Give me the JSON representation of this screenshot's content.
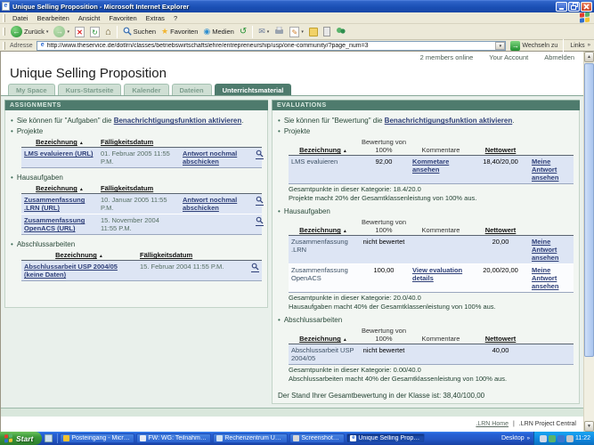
{
  "icons": {
    "ie_e": "e",
    "back": "←",
    "forward": "→",
    "stop": "✕",
    "refresh": "↻",
    "home": "⌂",
    "star": "★",
    "media": "◉",
    "history": "↺",
    "mail": "✉",
    "edit": "✎",
    "dropdown": "▾",
    "chevrons": "»",
    "go": "→",
    "sort": "▲",
    "up": "▲",
    "down": "▼",
    "bullet": "•",
    "pipe": "|"
  },
  "window": {
    "title": "Unique Selling Proposition - Microsoft Internet Explorer",
    "menu": [
      "Datei",
      "Bearbeiten",
      "Ansicht",
      "Favoriten",
      "Extras",
      "?"
    ],
    "toolbar": {
      "back_label": "Zurück",
      "search_label": "Suchen",
      "favorites_label": "Favoriten",
      "media_label": "Medien"
    },
    "addressbar": {
      "label": "Adresse",
      "url": "http://www.theservice.de/dotlrn/classes/betriebswirtschaftslehre/entrepreneurship/usp/one-community/?page_num=3",
      "go_label": "Wechseln zu",
      "links_label": "Links"
    }
  },
  "page": {
    "members_online": "2 members online",
    "your_account": "Your Account",
    "logout": "Abmelden",
    "title": "Unique Selling Proposition",
    "tabs": [
      "My Space",
      "Kurs-Startseite",
      "Kalender",
      "Dateien",
      "Unterrichtsmaterial"
    ],
    "active_tab": "Unterrichtsmaterial",
    "footer": {
      "home": ".LRN Home",
      "sep": "|",
      "central": ".LRN Project Central"
    }
  },
  "assignments": {
    "header": "ASSIGNMENTS",
    "notify": {
      "prefix": "Sie können für \"Aufgaben\" die ",
      "link": "Benachrichtigungsfunktion aktivieren",
      "suffix": "."
    },
    "cols": {
      "name": "Bezeichnung",
      "due": "Fälligkeitsdatum"
    },
    "projekte": {
      "title": "Projekte",
      "rows": [
        {
          "name": "LMS evaluieren (URL)",
          "due": "01. Februar 2005 11:55 P.M.",
          "action": "Antwort nochmal abschicken"
        }
      ]
    },
    "hausaufgaben": {
      "title": "Hausaufgaben",
      "rows": [
        {
          "name": "Zusammenfassung .LRN (URL)",
          "due": "10. Januar 2005 11:55 P.M.",
          "action": "Antwort nochmal abschicken"
        },
        {
          "name": "Zusammenfassung OpenACS (URL)",
          "due": "15. November 2004 11:55 P.M.",
          "action": ""
        }
      ]
    },
    "abschluss": {
      "title": "Abschlussarbeiten",
      "rows": [
        {
          "name": "Abschlussarbeit USP 2004/05 (keine Daten)",
          "due": "15. Februar 2004 11:55 P.M.",
          "action": ""
        }
      ]
    }
  },
  "evaluations": {
    "header": "EVALUATIONS",
    "notify": {
      "prefix": "Sie können für \"Bewertung\" die ",
      "link": "Benachrichtigungsfunktion aktivieren",
      "suffix": "."
    },
    "cols": {
      "name": "Bezeichnung",
      "grade": "Bewertung von 100%",
      "comments": "Kommentare",
      "net": "Nettowert"
    },
    "projekte": {
      "title": "Projekte",
      "rows": [
        {
          "name": "LMS evaluieren",
          "grade": "92,00",
          "comments": "Kommetare ansehen",
          "net": "18,40/20,00",
          "answer": "Meine Antwort ansehen"
        }
      ],
      "total": "Gesamtpunkte in dieser Kategorie: 18.4/20.0",
      "weight": "Projekte macht 20% der Gesamtklassenleistung von 100% aus."
    },
    "hausaufgaben": {
      "title": "Hausaufgaben",
      "rows": [
        {
          "name": "Zusammenfassung .LRN",
          "grade": "nicht bewertet",
          "comments": "",
          "net": "20,00",
          "answer": "Meine Antwort ansehen"
        },
        {
          "name": "Zusammenfassung OpenACS",
          "grade": "100,00",
          "comments": "View evaluation details",
          "net": "20,00/20,00",
          "answer": "Meine Antwort ansehen"
        }
      ],
      "total": "Gesamtpunkte in dieser Kategorie: 20.0/40.0",
      "weight": "Hausaufgaben macht 40% der Gesamtklassenleistung von 100% aus."
    },
    "abschluss": {
      "title": "Abschlussarbeiten",
      "rows": [
        {
          "name": "Abschlussarbeit USP 2004/05",
          "grade": "nicht bewertet",
          "comments": "",
          "net": "40,00",
          "answer": ""
        }
      ],
      "total": "Gesamtpunkte in dieser Kategorie: 0.00/40.0",
      "weight": "Abschlussarbeiten macht 40% der Gesamtklassenleistung von 100% aus."
    },
    "grand_total": "Der Stand Ihrer Gesamtbewertung in der Klasse ist: 38,40/100,00"
  },
  "taskbar": {
    "start": "Start",
    "buttons": [
      "Posteingang - Micros...",
      "FW: WG: Teilnahme v...",
      "Rechenzentrum Uni K...",
      "Screenshots dotLR...",
      "Unique Selling Proposi..."
    ],
    "desktop_label": "Desktop",
    "time": "11:22"
  },
  "colors": {
    "portlet_header": "#4e7b6d",
    "row_blue": "#dde5f4",
    "link": "#2e3f78",
    "content_bg": "#e9f0eb"
  }
}
